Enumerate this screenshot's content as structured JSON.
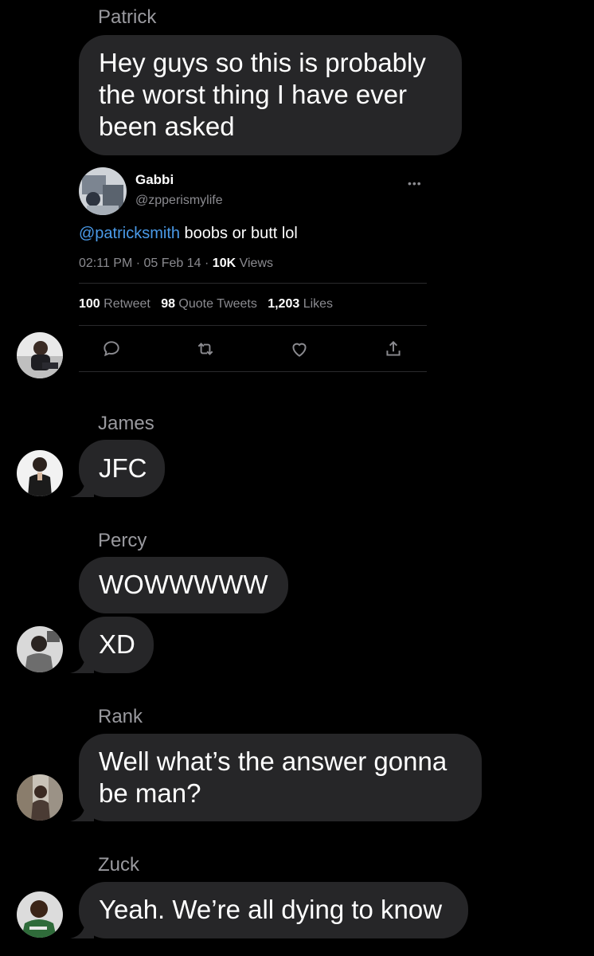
{
  "thread": {
    "patrick": {
      "name": "Patrick",
      "message": "Hey guys so this is probably the worst thing I have ever been asked"
    },
    "tweet": {
      "name": "Gabbi",
      "handle": "@zpperismylife",
      "more": "•••",
      "mention": "@patricksmith",
      "text": " boobs or butt lol",
      "date": "02:11 PM · 05 Feb 14 · ",
      "views_count": "10K",
      "views_label": " Views",
      "retweets_count": "100",
      "retweets_label": " Retweet",
      "quotes_count": "98",
      "quotes_label": " Quote Tweets",
      "likes_count": "1,203",
      "likes_label": " Likes",
      "actions": [
        "reply-icon",
        "retweet-icon",
        "like-icon",
        "share-icon"
      ]
    },
    "james": {
      "name": "James",
      "message": "JFC"
    },
    "percy": {
      "name": "Percy",
      "message1": "WOWWWWW",
      "message2": "XD"
    },
    "rank": {
      "name": "Rank",
      "message": "Well what’s the answer gonna be man?"
    },
    "zuck": {
      "name": "Zuck",
      "message": "Yeah. We’re all dying to know"
    }
  },
  "colors": {
    "background": "#000000",
    "bubble": "#262628",
    "sender_name": "#9a9a9f",
    "mention": "#4a9ae8"
  }
}
